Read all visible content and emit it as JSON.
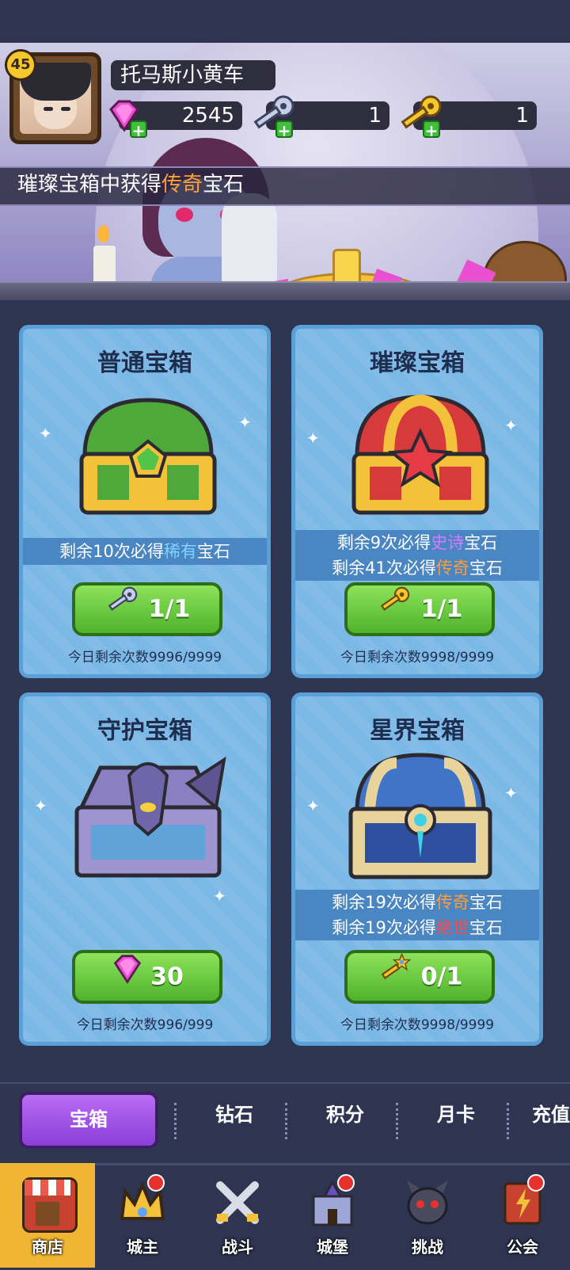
{
  "player": {
    "level": "45",
    "name": "托马斯小黄车"
  },
  "resources": {
    "gems": "2545",
    "silver_keys": "1",
    "gold_keys": "1"
  },
  "banner": {
    "prefix": "璀璨宝箱中获得",
    "highlight": "传奇",
    "suffix": "宝石"
  },
  "chests": [
    {
      "title": "普通宝箱",
      "info": [
        {
          "pre": "剩余10次必得",
          "hl": "稀有",
          "post": "宝石",
          "hl_color": "#7fd4ff"
        }
      ],
      "cost_icon": "silver-key-icon",
      "cost": "1/1",
      "daily": "今日剩余次数9996/9999"
    },
    {
      "title": "璀璨宝箱",
      "info": [
        {
          "pre": "剩余9次必得",
          "hl": "史诗",
          "post": "宝石",
          "hl_color": "#d47cff"
        },
        {
          "pre": "剩余41次必得",
          "hl": "传奇",
          "post": "宝石",
          "hl_color": "#ff9d3a"
        }
      ],
      "cost_icon": "gold-key-icon",
      "cost": "1/1",
      "daily": "今日剩余次数9998/9999"
    },
    {
      "title": "守护宝箱",
      "info": [],
      "cost_icon": "gem-icon",
      "cost": "30",
      "daily": "今日剩余次数996/999"
    },
    {
      "title": "星界宝箱",
      "info": [
        {
          "pre": "剩余19次必得",
          "hl": "传奇",
          "post": "宝石",
          "hl_color": "#ff9d3a"
        },
        {
          "pre": "剩余19次必得",
          "hl": "绝世",
          "post": "宝石",
          "hl_color": "#ff4a4a"
        }
      ],
      "cost_icon": "star-key-icon",
      "cost": "0/1",
      "daily": "今日剩余次数9998/9999"
    }
  ],
  "tabs": [
    "宝箱",
    "钻石",
    "积分",
    "月卡",
    "充值"
  ],
  "nav": [
    {
      "label": "商店",
      "icon": "shop-icon",
      "badge": false
    },
    {
      "label": "城主",
      "icon": "crown-icon",
      "badge": true
    },
    {
      "label": "战斗",
      "icon": "swords-icon",
      "badge": false
    },
    {
      "label": "城堡",
      "icon": "castle-icon",
      "badge": true
    },
    {
      "label": "挑战",
      "icon": "demon-icon",
      "badge": false
    },
    {
      "label": "公会",
      "icon": "guild-book-icon",
      "badge": true
    }
  ],
  "colors": {
    "card_bg": "#7ab8e6",
    "button_green": "#4eb32b",
    "tab_active": "#8a3fd9",
    "nav_active": "#f0b533"
  }
}
